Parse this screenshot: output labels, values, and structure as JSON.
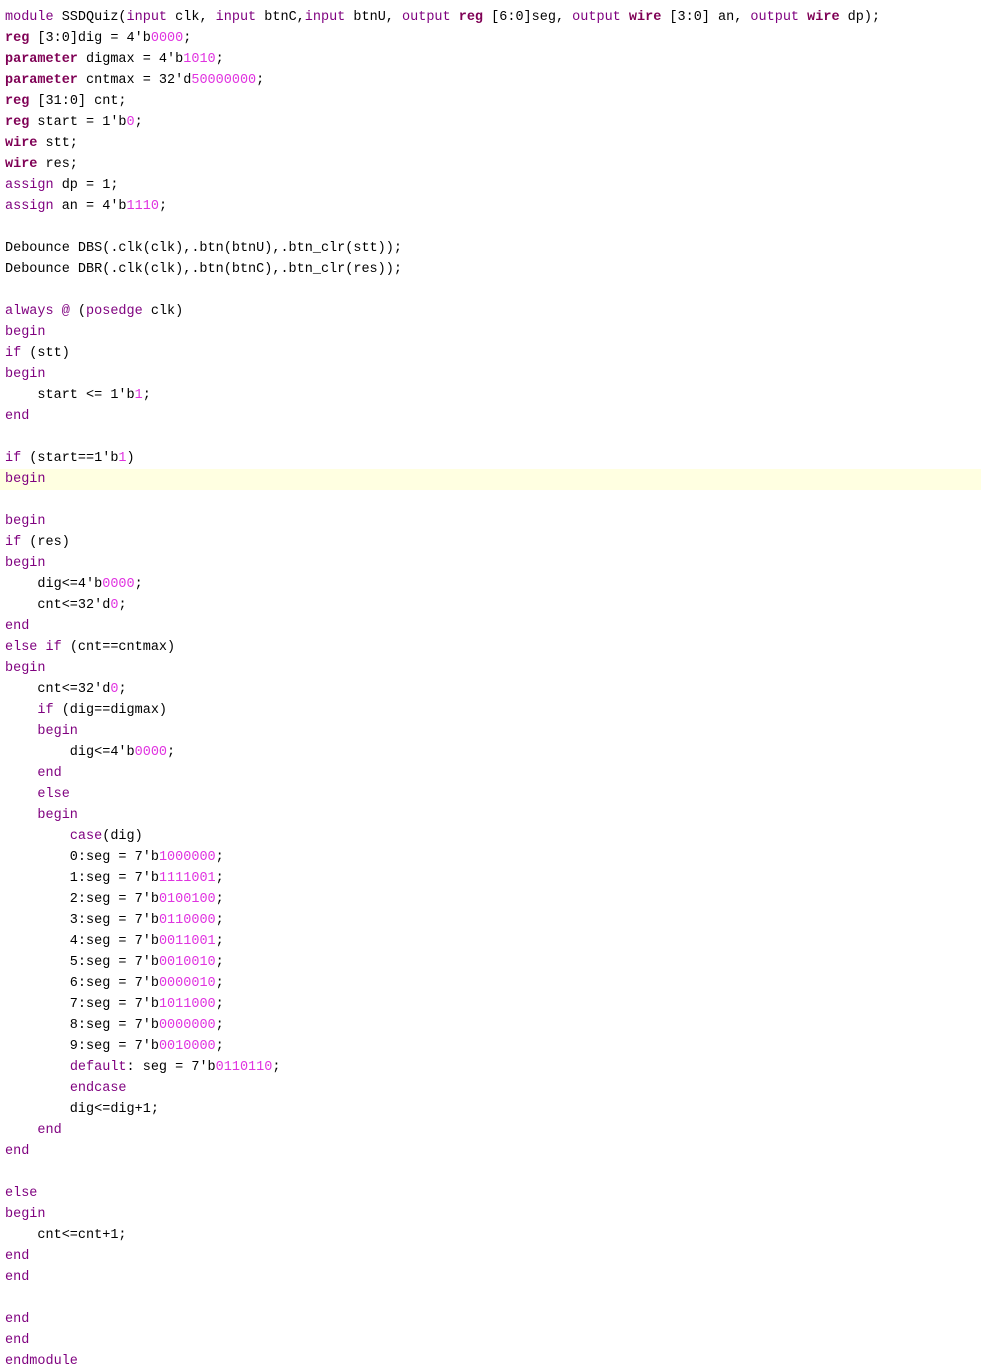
{
  "editor": {
    "language": "verilog",
    "highlighted_line_index": 22,
    "colors": {
      "background": "#ffffff",
      "keyword": "#7f007f",
      "type_keyword": "#7f0055",
      "number": "#e033e0",
      "plain": "#000000",
      "current_line": "#ffffe1"
    },
    "lines": [
      [
        [
          "kw",
          "module"
        ],
        [
          "p",
          " SSDQuiz("
        ],
        [
          "kw",
          "input"
        ],
        [
          "p",
          " clk, "
        ],
        [
          "kw",
          "input"
        ],
        [
          "p",
          " btnC,"
        ],
        [
          "kw",
          "input"
        ],
        [
          "p",
          " btnU, "
        ],
        [
          "kw",
          "output"
        ],
        [
          "p",
          " "
        ],
        [
          "ty",
          "reg"
        ],
        [
          "p",
          " [6:0]seg, "
        ],
        [
          "kw",
          "output"
        ],
        [
          "p",
          " "
        ],
        [
          "ty",
          "wire"
        ],
        [
          "p",
          " [3:0] an, "
        ],
        [
          "kw",
          "output"
        ],
        [
          "p",
          " "
        ],
        [
          "ty",
          "wire"
        ],
        [
          "p",
          " dp);"
        ]
      ],
      [
        [
          "ty",
          "reg"
        ],
        [
          "p",
          " [3:0]dig = 4'b"
        ],
        [
          "num",
          "0000"
        ],
        [
          "p",
          ";"
        ]
      ],
      [
        [
          "ty",
          "parameter"
        ],
        [
          "p",
          " digmax = 4'b"
        ],
        [
          "num",
          "1010"
        ],
        [
          "p",
          ";"
        ]
      ],
      [
        [
          "ty",
          "parameter"
        ],
        [
          "p",
          " cntmax = 32'd"
        ],
        [
          "num",
          "50000000"
        ],
        [
          "p",
          ";"
        ]
      ],
      [
        [
          "ty",
          "reg"
        ],
        [
          "p",
          " [31:0] cnt;"
        ]
      ],
      [
        [
          "ty",
          "reg"
        ],
        [
          "p",
          " start = 1'b"
        ],
        [
          "num",
          "0"
        ],
        [
          "p",
          ";"
        ]
      ],
      [
        [
          "ty",
          "wire"
        ],
        [
          "p",
          " stt;"
        ]
      ],
      [
        [
          "ty",
          "wire"
        ],
        [
          "p",
          " res;"
        ]
      ],
      [
        [
          "kw",
          "assign"
        ],
        [
          "p",
          " dp = 1;"
        ]
      ],
      [
        [
          "kw",
          "assign"
        ],
        [
          "p",
          " an = 4'b"
        ],
        [
          "num",
          "1110"
        ],
        [
          "p",
          ";"
        ]
      ],
      [],
      [
        [
          "p",
          "Debounce DBS(.clk(clk),.btn(btnU),.btn_clr(stt));"
        ]
      ],
      [
        [
          "p",
          "Debounce DBR(.clk(clk),.btn(btnC),.btn_clr(res));"
        ]
      ],
      [],
      [
        [
          "kw",
          "always"
        ],
        [
          "p",
          " "
        ],
        [
          "kw",
          "@"
        ],
        [
          "p",
          " ("
        ],
        [
          "kw",
          "posedge"
        ],
        [
          "p",
          " clk)"
        ]
      ],
      [
        [
          "kw",
          "begin"
        ]
      ],
      [
        [
          "kw",
          "if"
        ],
        [
          "p",
          " (stt)"
        ]
      ],
      [
        [
          "kw",
          "begin"
        ]
      ],
      [
        [
          "p",
          "    start <= 1'b"
        ],
        [
          "num",
          "1"
        ],
        [
          "p",
          ";"
        ]
      ],
      [
        [
          "kw",
          "end"
        ]
      ],
      [],
      [
        [
          "kw",
          "if"
        ],
        [
          "p",
          " (start==1'b"
        ],
        [
          "num",
          "1"
        ],
        [
          "p",
          ")"
        ]
      ],
      [
        [
          "kw",
          "begin"
        ]
      ],
      [],
      [
        [
          "kw",
          "begin"
        ]
      ],
      [
        [
          "kw",
          "if"
        ],
        [
          "p",
          " (res)"
        ]
      ],
      [
        [
          "kw",
          "begin"
        ]
      ],
      [
        [
          "p",
          "    dig<=4'b"
        ],
        [
          "num",
          "0000"
        ],
        [
          "p",
          ";"
        ]
      ],
      [
        [
          "p",
          "    cnt<=32'd"
        ],
        [
          "num",
          "0"
        ],
        [
          "p",
          ";"
        ]
      ],
      [
        [
          "kw",
          "end"
        ]
      ],
      [
        [
          "kw",
          "else"
        ],
        [
          "p",
          " "
        ],
        [
          "kw",
          "if"
        ],
        [
          "p",
          " (cnt==cntmax)"
        ]
      ],
      [
        [
          "kw",
          "begin"
        ]
      ],
      [
        [
          "p",
          "    cnt<=32'd"
        ],
        [
          "num",
          "0"
        ],
        [
          "p",
          ";"
        ]
      ],
      [
        [
          "p",
          "    "
        ],
        [
          "kw",
          "if"
        ],
        [
          "p",
          " (dig==digmax)"
        ]
      ],
      [
        [
          "p",
          "    "
        ],
        [
          "kw",
          "begin"
        ]
      ],
      [
        [
          "p",
          "        dig<=4'b"
        ],
        [
          "num",
          "0000"
        ],
        [
          "p",
          ";"
        ]
      ],
      [
        [
          "p",
          "    "
        ],
        [
          "kw",
          "end"
        ]
      ],
      [
        [
          "p",
          "    "
        ],
        [
          "kw",
          "else"
        ]
      ],
      [
        [
          "p",
          "    "
        ],
        [
          "kw",
          "begin"
        ]
      ],
      [
        [
          "p",
          "        "
        ],
        [
          "kw",
          "case"
        ],
        [
          "p",
          "(dig)"
        ]
      ],
      [
        [
          "p",
          "        0:seg = 7'b"
        ],
        [
          "num",
          "1000000"
        ],
        [
          "p",
          ";"
        ]
      ],
      [
        [
          "p",
          "        1:seg = 7'b"
        ],
        [
          "num",
          "1111001"
        ],
        [
          "p",
          ";"
        ]
      ],
      [
        [
          "p",
          "        2:seg = 7'b"
        ],
        [
          "num",
          "0100100"
        ],
        [
          "p",
          ";"
        ]
      ],
      [
        [
          "p",
          "        3:seg = 7'b"
        ],
        [
          "num",
          "0110000"
        ],
        [
          "p",
          ";"
        ]
      ],
      [
        [
          "p",
          "        4:seg = 7'b"
        ],
        [
          "num",
          "0011001"
        ],
        [
          "p",
          ";"
        ]
      ],
      [
        [
          "p",
          "        5:seg = 7'b"
        ],
        [
          "num",
          "0010010"
        ],
        [
          "p",
          ";"
        ]
      ],
      [
        [
          "p",
          "        6:seg = 7'b"
        ],
        [
          "num",
          "0000010"
        ],
        [
          "p",
          ";"
        ]
      ],
      [
        [
          "p",
          "        7:seg = 7'b"
        ],
        [
          "num",
          "1011000"
        ],
        [
          "p",
          ";"
        ]
      ],
      [
        [
          "p",
          "        8:seg = 7'b"
        ],
        [
          "num",
          "0000000"
        ],
        [
          "p",
          ";"
        ]
      ],
      [
        [
          "p",
          "        9:seg = 7'b"
        ],
        [
          "num",
          "0010000"
        ],
        [
          "p",
          ";"
        ]
      ],
      [
        [
          "p",
          "        "
        ],
        [
          "kw",
          "default"
        ],
        [
          "p",
          ": seg = 7'b"
        ],
        [
          "num",
          "0110110"
        ],
        [
          "p",
          ";"
        ]
      ],
      [
        [
          "p",
          "        "
        ],
        [
          "kw",
          "endcase"
        ]
      ],
      [
        [
          "p",
          "        dig<=dig+1;"
        ]
      ],
      [
        [
          "p",
          "    "
        ],
        [
          "kw",
          "end"
        ]
      ],
      [
        [
          "kw",
          "end"
        ]
      ],
      [],
      [
        [
          "kw",
          "else"
        ]
      ],
      [
        [
          "kw",
          "begin"
        ]
      ],
      [
        [
          "p",
          "    cnt<=cnt+1;"
        ]
      ],
      [
        [
          "kw",
          "end"
        ]
      ],
      [
        [
          "kw",
          "end"
        ]
      ],
      [],
      [
        [
          "kw",
          "end"
        ]
      ],
      [
        [
          "kw",
          "end"
        ]
      ],
      [
        [
          "kw",
          "endmodule"
        ]
      ]
    ]
  }
}
